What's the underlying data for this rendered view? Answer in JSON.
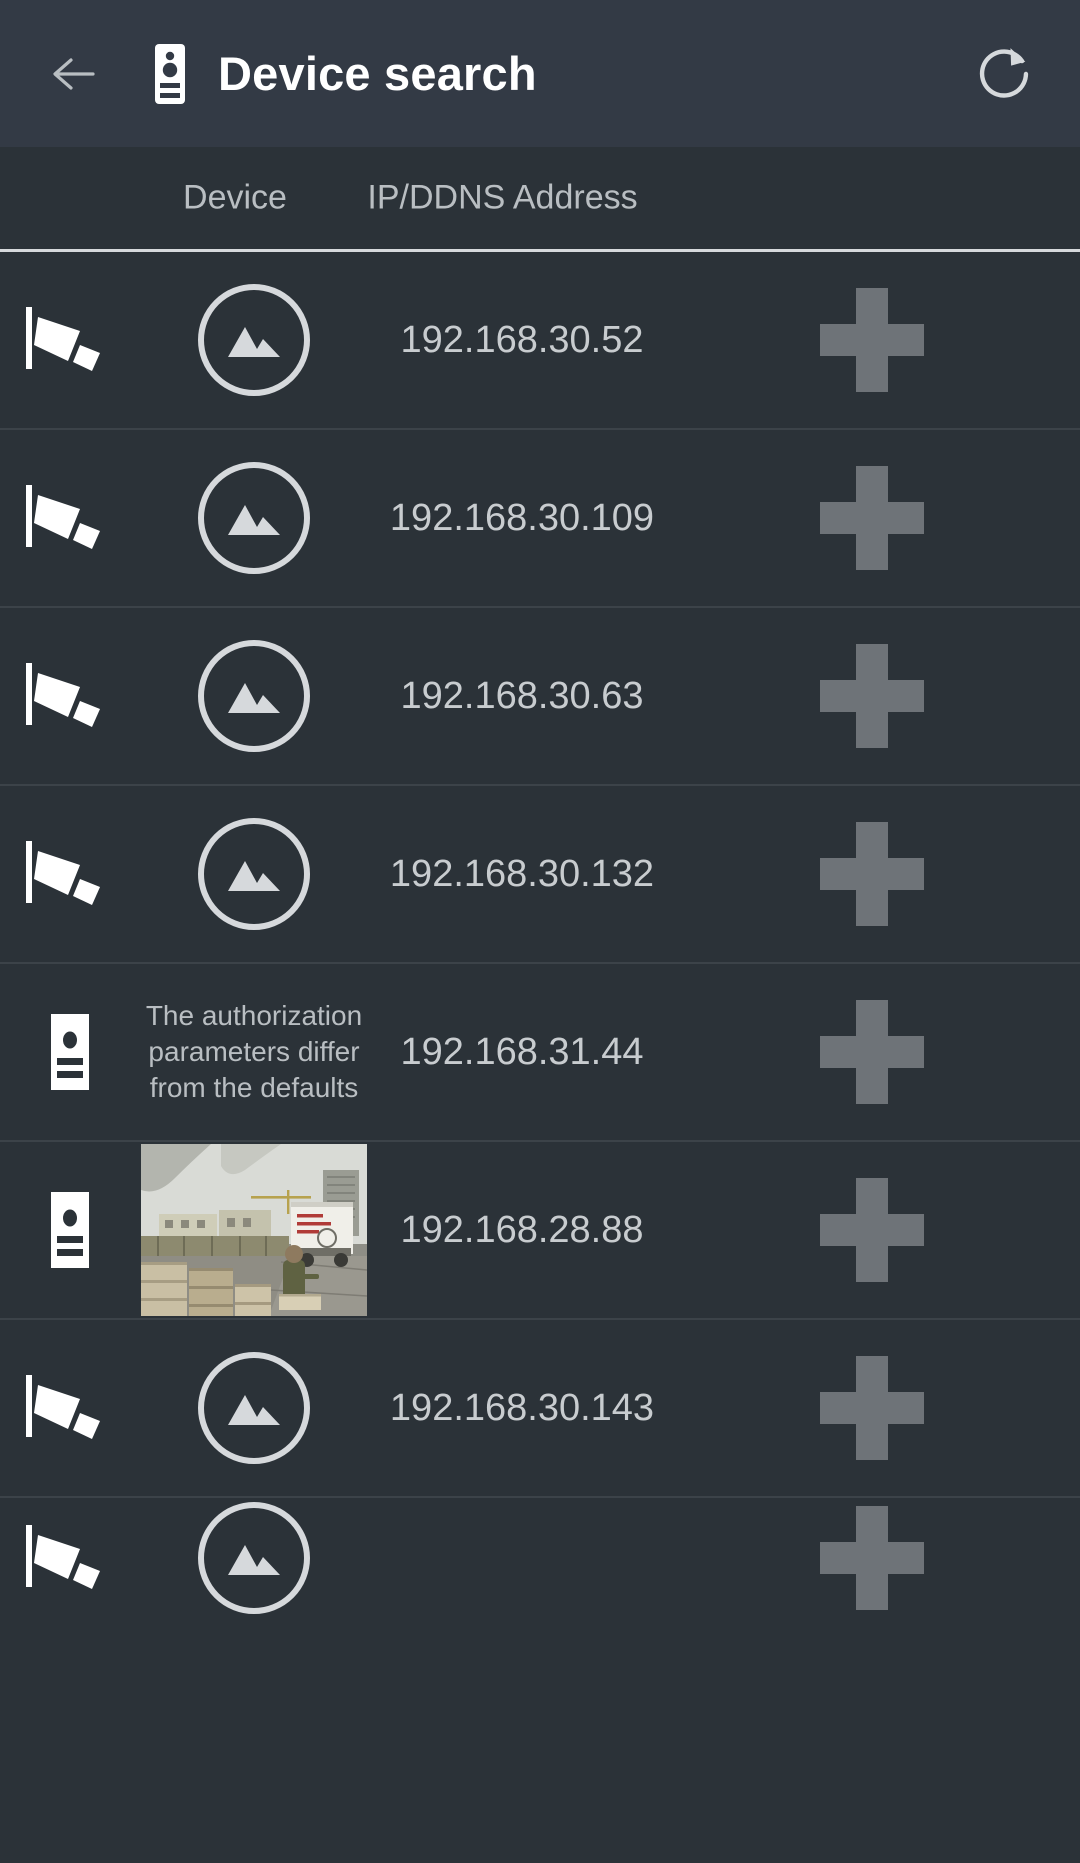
{
  "header": {
    "back_label": "Back",
    "device_icon": "door-station-icon",
    "title": "Device search",
    "refresh_label": "Refresh",
    "bg_color": "#333a45",
    "title_color": "#ffffff"
  },
  "columns": {
    "device": "Device",
    "address": "IP/DDNS Address"
  },
  "theme": {
    "body_bg": "#2b3238",
    "row_divider": "#3c4349",
    "text_primary": "#c8cccf",
    "text_secondary": "#b9bec2",
    "plus_color": "#6e7378",
    "icon_color": "#ffffff"
  },
  "add_button_label": "+",
  "devices": [
    {
      "device_type": "camera",
      "preview": "placeholder",
      "note": "",
      "address": "192.168.30.52",
      "action": "add"
    },
    {
      "device_type": "camera",
      "preview": "placeholder",
      "note": "",
      "address": "192.168.30.109",
      "action": "add"
    },
    {
      "device_type": "camera",
      "preview": "placeholder",
      "note": "",
      "address": "192.168.30.63",
      "action": "add"
    },
    {
      "device_type": "camera",
      "preview": "placeholder",
      "note": "",
      "address": "192.168.30.132",
      "action": "add"
    },
    {
      "device_type": "door-station",
      "preview": "message",
      "note": "The authorization parameters differ from the defaults",
      "address": "192.168.31.44",
      "action": "add"
    },
    {
      "device_type": "door-station",
      "preview": "video",
      "note": "",
      "address": "192.168.28.88",
      "action": "add"
    },
    {
      "device_type": "camera",
      "preview": "placeholder",
      "note": "",
      "address": "192.168.30.143",
      "action": "add"
    },
    {
      "device_type": "camera",
      "preview": "placeholder",
      "note": "",
      "address": "",
      "action": "add"
    }
  ]
}
